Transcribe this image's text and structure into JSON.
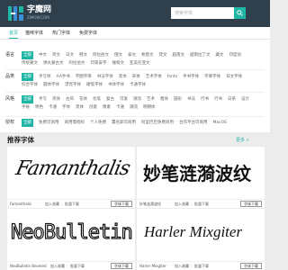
{
  "brand": {
    "name": "字魔网",
    "tagline": "ZIMOW.COM"
  },
  "search": {
    "placeholder": "搜索字体"
  },
  "nav": {
    "items": [
      "首页",
      "猫咪字体",
      "热门字体",
      "免费字体"
    ],
    "active": 0
  },
  "filters": [
    {
      "label": "语言",
      "items": [
        "全部",
        "中文",
        "英文",
        "日文",
        "韩文",
        "阿拉伯文",
        "俄文",
        "泰文",
        "希腊文",
        "梵文",
        "越南文",
        "越南拉丁文",
        "藏文",
        "印度语",
        "传统蒙文",
        "弹丸蒙古文",
        "阿拉伯文",
        "印第安字",
        "缅甸文",
        "亚美尼亚文"
      ],
      "selected": 0
    },
    {
      "label": "品类",
      "items": [
        "全部",
        "手写体",
        "AA手书",
        "字圈字库",
        "书法字体",
        "黑体",
        "宋体",
        "艺术字体",
        "fonts",
        "手书字体",
        "字库字体",
        "日文字体",
        "综合字体",
        "圆体字体",
        "漂亮字体",
        "硬笔字体",
        "书体字体",
        "卡通字体"
      ],
      "selected": 0
    },
    {
      "label": "风格",
      "items": [
        "全部",
        "手写",
        "英体",
        "古风",
        "花体",
        "毛笔",
        "复古",
        "可爱",
        "潮流",
        "艺术",
        "粗体",
        "圆形",
        "书法",
        "行书",
        "行书",
        "日系",
        "设计",
        "手账",
        "特色",
        "卡通",
        "字体",
        "黑体",
        "创意",
        "像素",
        "卡通",
        "潮流",
        "明朝体"
      ],
      "selected": 0
    },
    {
      "label": "授权",
      "items": [
        "全部",
        "免费可商用",
        "商用需授权",
        "个人免费",
        "署名即可商用",
        "阿里巴巴免费商用",
        "合作平台可商用",
        "MacOS"
      ],
      "selected": 0
    }
  ],
  "section": {
    "title": "推荐字体",
    "more": "更多 »"
  },
  "card_actions": {
    "fav": "加入收藏",
    "compare": "批量下载",
    "download": "字体下载"
  },
  "cards": [
    {
      "name": "Famanthalis",
      "preview": "Famanthalis"
    },
    {
      "name": "妙笔涟漪波纹",
      "preview": "妙笔涟漪波纹"
    },
    {
      "name": "NeoBulletin Beveled",
      "preview": "NeoBulletin"
    },
    {
      "name": "Harler Mixgiter",
      "preview": "Harler Mixgiter"
    }
  ],
  "colors": {
    "accent": "#1fb6a6",
    "header": "#2f3f4b"
  }
}
